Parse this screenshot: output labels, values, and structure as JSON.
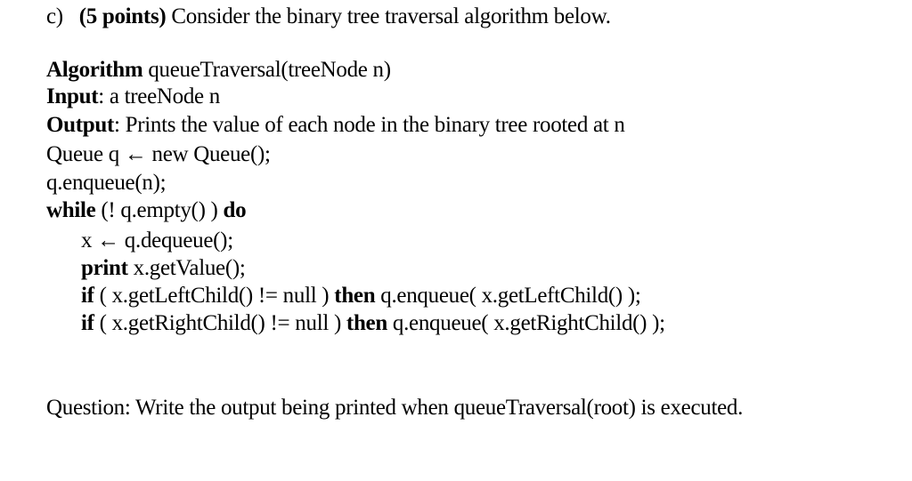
{
  "header": {
    "label": "c)",
    "points": "(5 points)",
    "text": " Consider the binary tree traversal algorithm below."
  },
  "algorithm": {
    "keyword": "Algorithm",
    "signature": " queueTraversal(treeNode n)",
    "input_label": "Input",
    "input_text": ": a treeNode n",
    "output_label": "Output",
    "output_text": ": Prints the value of each node in the binary tree rooted at n",
    "line_queue": "Queue q ← new Queue();",
    "line_enqueue": "q.enqueue(n);",
    "while_kw": "while",
    "while_cond": " (! q.empty() ) ",
    "do_kw": "do",
    "body": {
      "dequeue": "x ← q.dequeue();",
      "print_kw": "print",
      "print_expr": " x.getValue();",
      "if_kw": "if",
      "left_cond": " ( x.getLeftChild() != null ) ",
      "then_kw": "then",
      "left_action": " q.enqueue( x.getLeftChild() );",
      "right_cond": " ( x.getRightChild() != null ) ",
      "right_action": " q.enqueue( x.getRightChild() );"
    }
  },
  "question": "Question: Write the output being printed when queueTraversal(root) is executed."
}
